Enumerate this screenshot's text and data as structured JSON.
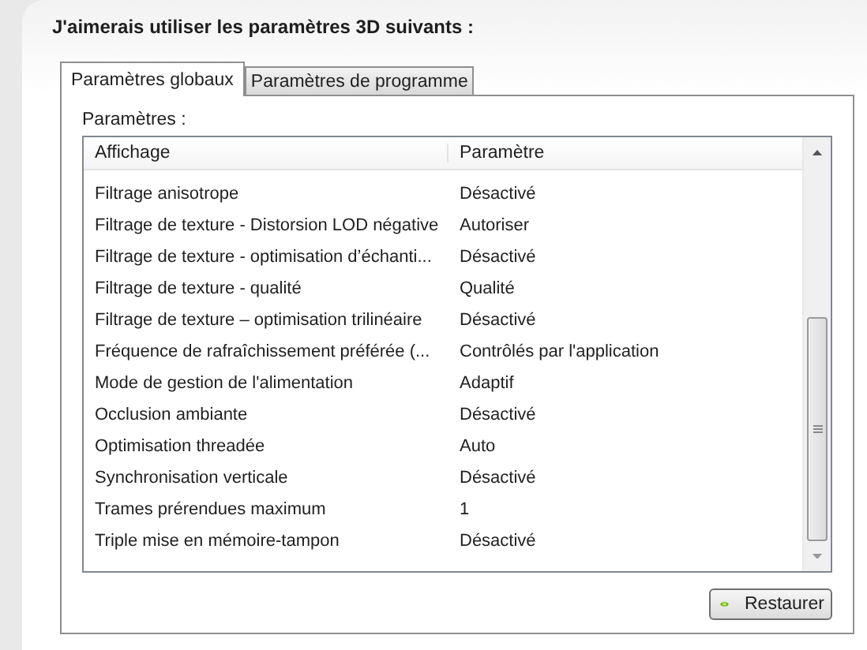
{
  "heading": "J'aimerais utiliser les paramètres 3D suivants :",
  "tabs": [
    {
      "label": "Paramètres globaux",
      "selected": true
    },
    {
      "label": "Paramètres de programme",
      "selected": false
    }
  ],
  "settings_label": "Paramètres :",
  "table": {
    "columns": [
      "Affichage",
      "Paramètre"
    ],
    "rows": [
      [
        "Filtrage anisotrope",
        "Désactivé"
      ],
      [
        "Filtrage de texture - Distorsion LOD négative",
        "Autoriser"
      ],
      [
        "Filtrage de texture - optimisation d’échanti...",
        "Désactivé"
      ],
      [
        "Filtrage de texture - qualité",
        "Qualité"
      ],
      [
        "Filtrage de texture – optimisation trilinéaire",
        "Désactivé"
      ],
      [
        "Fréquence de rafraîchissement préférée (...",
        "Contrôlés par l'application"
      ],
      [
        "Mode de gestion de l'alimentation",
        "Adaptif"
      ],
      [
        "Occlusion ambiante",
        "Désactivé"
      ],
      [
        "Optimisation threadée",
        "Auto"
      ],
      [
        "Synchronisation verticale",
        "Désactivé"
      ],
      [
        "Trames prérendues maximum",
        "1"
      ],
      [
        "Triple mise en mémoire-tampon",
        "Désactivé"
      ]
    ]
  },
  "buttons": [
    "Restaurer"
  ]
}
